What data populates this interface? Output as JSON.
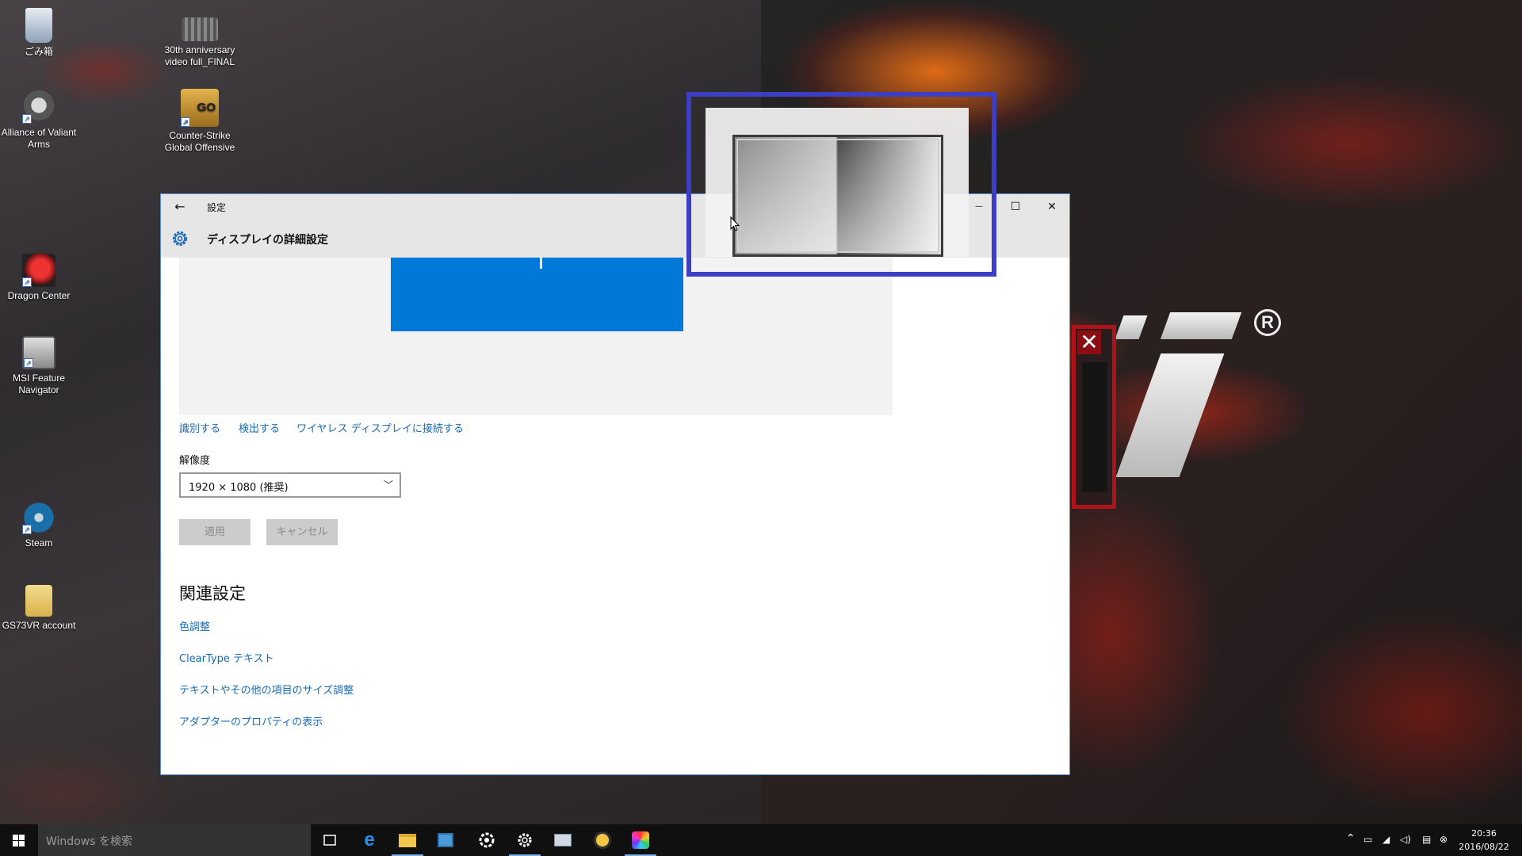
{
  "desktop": {
    "icons": [
      {
        "label": "ごみ箱"
      },
      {
        "label": "30th anniversary video full_FINAL"
      },
      {
        "label": "Alliance of Valiant Arms"
      },
      {
        "label": "Counter-Strike Global Offensive"
      },
      {
        "label": "Dragon Center"
      },
      {
        "label": "MSI Feature Navigator"
      },
      {
        "label": "Steam"
      },
      {
        "label": "GS73VR account"
      }
    ],
    "go_badge": "GO",
    "registered_mark": "R",
    "red_close": "✕"
  },
  "window": {
    "back_icon": "←",
    "title": "設定",
    "minimize_icon": "—",
    "maximize_icon": "☐",
    "close_icon": "✕",
    "page_title": "ディスプレイの詳細設定",
    "links": {
      "identify": "識別する",
      "detect": "検出する",
      "wireless": "ワイヤレス ディスプレイに接続する"
    },
    "resolution_label": "解像度",
    "resolution_value": "1920 × 1080 (推奨)",
    "apply_button": "適用",
    "cancel_button": "キャンセル",
    "related_title": "関連設定",
    "related_links": [
      "色調整",
      "ClearType テキスト",
      "テキストやその他の項目のサイズ調整",
      "アダプターのプロパティの表示"
    ]
  },
  "taskbar": {
    "search_placeholder": "Windows を検索",
    "time": "20:36",
    "date": "2016/08/22",
    "accent_color": "#79b2ea"
  }
}
